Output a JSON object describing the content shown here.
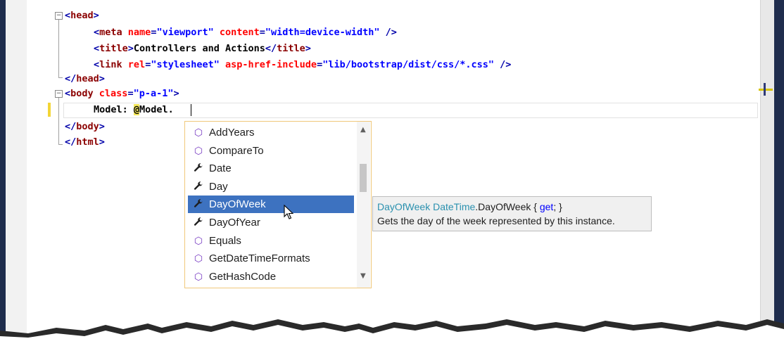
{
  "code": {
    "line1": {
      "open": "<",
      "tag": "head",
      "close": ">"
    },
    "line2": {
      "open": "<",
      "tag": "meta",
      "a1": "name",
      "eq1": "=",
      "v1": "\"viewport\"",
      "a2": "content",
      "eq2": "=",
      "v2": "\"width=device-width\"",
      "close": " />"
    },
    "line3": {
      "open": "<",
      "tag": "title",
      "close1": ">",
      "text": "Controllers and Actions",
      "open2": "</",
      "tag2": "title",
      "close2": ">"
    },
    "line4": {
      "open": "<",
      "tag": "link",
      "a1": "rel",
      "eq1": "=",
      "v1": "\"stylesheet\"",
      "a2": "asp-href-include",
      "eq2": "=",
      "v2": "\"lib/bootstrap/dist/css/*.css\"",
      "close": " />"
    },
    "line5": {
      "open": "</",
      "tag": "head",
      "close": ">"
    },
    "line6": {
      "open": "<",
      "tag": "body",
      "a1": "class",
      "eq1": "=",
      "v1": "\"p-a-1\"",
      "close": ">"
    },
    "line7": {
      "text": "Model: ",
      "at": "@",
      "expr": "Model."
    },
    "line8": {
      "open": "</",
      "tag": "body",
      "close": ">"
    },
    "line9": {
      "open": "</",
      "tag": "html",
      "close": ">"
    }
  },
  "fold_glyph": "−",
  "completion": {
    "items": [
      {
        "label": "AddYears",
        "icon": "method-icon",
        "glyph": "⬡"
      },
      {
        "label": "CompareTo",
        "icon": "method-icon",
        "glyph": "⬡"
      },
      {
        "label": "Date",
        "icon": "wrench-icon",
        "glyph": "🔧"
      },
      {
        "label": "Day",
        "icon": "wrench-icon",
        "glyph": "🔧"
      },
      {
        "label": "DayOfWeek",
        "icon": "wrench-icon",
        "glyph": "🔧"
      },
      {
        "label": "DayOfYear",
        "icon": "wrench-icon",
        "glyph": "🔧"
      },
      {
        "label": "Equals",
        "icon": "method-icon",
        "glyph": "⬡"
      },
      {
        "label": "GetDateTimeFormats",
        "icon": "method-icon",
        "glyph": "⬡"
      },
      {
        "label": "GetHashCode",
        "icon": "method-icon",
        "glyph": "⬡"
      }
    ],
    "selected_label": "DayOfWeek",
    "up_arrow": "▲",
    "down_arrow": "▼"
  },
  "tooltip": {
    "member": "DayOfWeek",
    "type": "DateTime",
    "dot_member": ".DayOfWeek { ",
    "keyword": "get",
    "tail": "; }",
    "description": "Gets the day of the week represented by this instance."
  },
  "colors": {
    "tag": "#8b0000",
    "attribute": "#ff0000",
    "value": "#0000ff",
    "selection": "#3d72c0",
    "razor_highlight": "#f5e85a"
  }
}
